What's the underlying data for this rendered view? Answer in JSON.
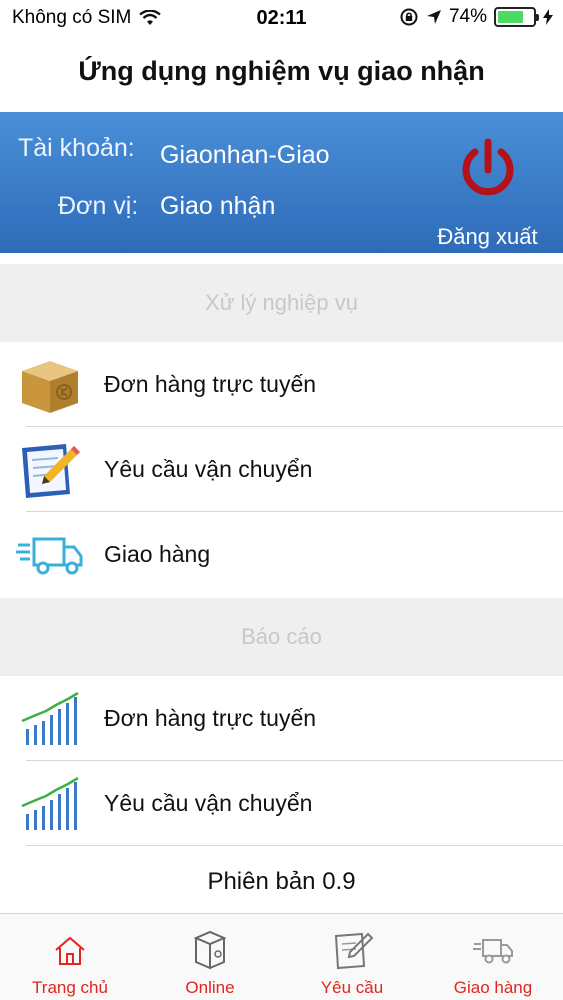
{
  "status_bar": {
    "carrier": "Không có SIM",
    "time": "02:11",
    "battery_percent": "74%",
    "battery_level": 0.74,
    "battery_color": "#4cd964"
  },
  "header": {
    "title": "Ứng dụng nghiệm vụ giao nhận"
  },
  "account": {
    "account_label": "Tài khoản:",
    "account_value": "Giaonhan-Giao",
    "unit_label": "Đơn vị:",
    "unit_value": "Giao nhận",
    "logout_label": "Đăng xuất",
    "banner_color": "#3a7dc9",
    "logout_icon_color": "#b3121a"
  },
  "sections": [
    {
      "title": "Xử lý nghiệp vụ",
      "items": [
        {
          "label": "Đơn hàng trực tuyến",
          "icon": "package-box-icon"
        },
        {
          "label": "Yêu cầu vận chuyển",
          "icon": "edit-document-icon"
        },
        {
          "label": "Giao hàng",
          "icon": "delivery-truck-icon"
        }
      ]
    },
    {
      "title": "Báo cáo",
      "items": [
        {
          "label": "Đơn hàng trực tuyến",
          "icon": "bar-chart-icon"
        },
        {
          "label": "Yêu cầu vận chuyển",
          "icon": "bar-chart-icon"
        }
      ]
    }
  ],
  "footer": {
    "version": "Phiên bản 0.9"
  },
  "tab_bar": {
    "accent_color": "#e0261e",
    "tabs": [
      {
        "label": "Trang chủ",
        "icon": "home-icon"
      },
      {
        "label": "Online",
        "icon": "box-icon"
      },
      {
        "label": "Yêu cầu",
        "icon": "edit-document-icon"
      },
      {
        "label": "Giao hàng",
        "icon": "delivery-truck-icon"
      }
    ]
  }
}
